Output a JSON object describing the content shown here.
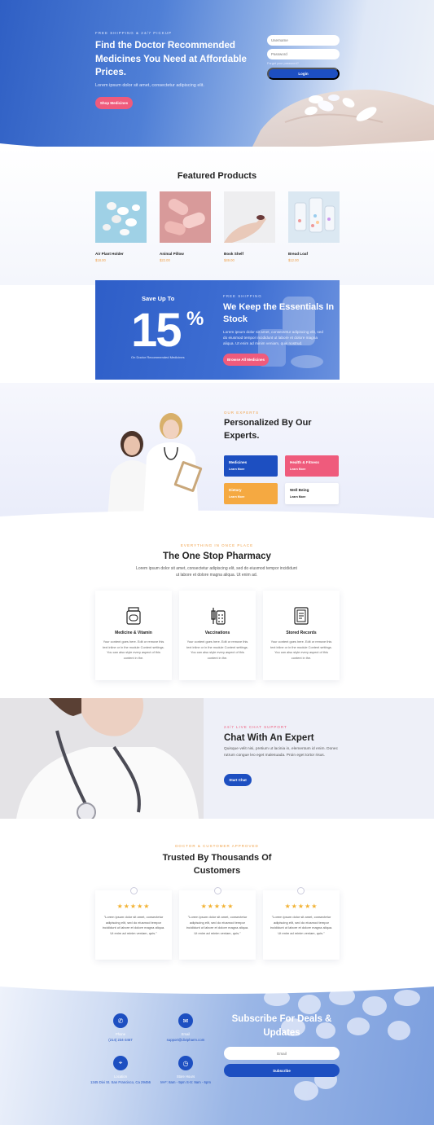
{
  "hero": {
    "eyebrow": "FREE SHIPPING & 24/7 PICKUP",
    "title": "Find the Doctor Recommended Medicines You Need at Affordable Prices.",
    "subtitle": "Lorem ipsum dolor sit amet, consectetur adipiscing elit.",
    "button": "Shop Medicines",
    "login": {
      "username_placeholder": "Username",
      "password_placeholder": "Password",
      "forgot": "Forgot your password?",
      "button": "Login"
    }
  },
  "featured": {
    "title": "Featured Products",
    "products": [
      {
        "name": "Air Plant Holder",
        "price": "$18.00"
      },
      {
        "name": "Animal Pillow",
        "price": "$22.00"
      },
      {
        "name": "Book Shelf",
        "price": "$49.00"
      },
      {
        "name": "Bread Loaf",
        "price": "$12.00"
      }
    ]
  },
  "promo": {
    "save": "Save Up To",
    "number": "15",
    "percent": "%",
    "under": "On Doctor Recommended Medicines",
    "eyebrow": "FREE SHIPPING",
    "title": "We Keep the Essentials In Stock",
    "text": "Lorem ipsum dolor sit amet, consectetur adipiscing elit, sed do eiusmod tempor incididunt ut labore et dolore magna aliqua. Ut enim ad minim veniam, quis nostrud.",
    "button": "Browse All Medicines"
  },
  "experts": {
    "eyebrow": "OUR EXPERTS",
    "title": "Personalized By Our Experts.",
    "tiles": [
      {
        "title": "Medicines",
        "link": "Learn More",
        "bg": "#1d4fc1",
        "fg": "#ffffff"
      },
      {
        "title": "Health & Fitness",
        "link": "Learn More",
        "bg": "#ef5b7c",
        "fg": "#ffffff"
      },
      {
        "title": "Dietary",
        "link": "Learn More",
        "bg": "#f5a941",
        "fg": "#ffffff"
      },
      {
        "title": "Well Being",
        "link": "Learn More",
        "bg": "#ffffff",
        "fg": "#222222"
      }
    ]
  },
  "pharmacy": {
    "eyebrow": "EVERYTHING IN ONCE PLACE",
    "title": "The One Stop Pharmacy",
    "subtitle": "Lorem ipsum dolor sit amet, consectetur adipiscing elit, sed do eiusmod tempor incididunt ut labore et dolore magna aliqua. Ut enim ad.",
    "cards": [
      {
        "icon": "medicine-jar-icon",
        "title": "Medicine & Vitamin",
        "text": "Your content goes here. Edit or remove this text inline or in the module Content settings. You can also style every aspect of this content in the."
      },
      {
        "icon": "vaccination-icon",
        "title": "Vaccinations",
        "text": "Your content goes here. Edit or remove this text inline or in the module Content settings. You can also style every aspect of this content in the."
      },
      {
        "icon": "records-icon",
        "title": "Stored Records",
        "text": "Your content goes here. Edit or remove this text inline or in the module Content settings. You can also style every aspect of this content in the."
      }
    ]
  },
  "chat": {
    "eyebrow": "24/7 LIVE CHAT SUPPORT",
    "title": "Chat With An Expert",
    "text": "Quisque velit nisi, pretium ut lacinia in, elementum id enim. Donec rutrum congue leo eget malesuada. Proin eget tortor risus.",
    "button": "Start Chat"
  },
  "testimonials": {
    "eyebrow": "DOCTOR & CUSTOMER APPROVED",
    "title": "Trusted By Thousands Of Customers",
    "items": [
      {
        "stars": "★★★★★",
        "quote": "\"Lorem ipsum dolor sit amet, consectetur adipiscing elit, sed do eiusmod tempor incididunt ut labore et dolore magna aliqua. Ut enim ad minim veniam, quis.\""
      },
      {
        "stars": "★★★★★",
        "quote": "\"Lorem ipsum dolor sit amet, consectetur adipiscing elit, sed do eiusmod tempor incididunt ut labore et dolore magna aliqua. Ut enim ad minim veniam, quis.\""
      },
      {
        "stars": "★★★★★",
        "quote": "\"Lorem ipsum dolor sit amet, consectetur adipiscing elit, sed do eiusmod tempor incididunt ut labore et dolore magna aliqua. Ut enim ad minim veniam, quis.\""
      }
    ]
  },
  "footer": {
    "contacts": [
      {
        "icon": "phone-icon",
        "glyph": "✆",
        "label": "Phone",
        "value": "(214) 234-3467"
      },
      {
        "icon": "email-icon",
        "glyph": "✉",
        "label": "Email",
        "value": "support@divipharm.com"
      },
      {
        "icon": "location-icon",
        "glyph": "⌖",
        "label": "Location",
        "value": "1345 Divi St. San Francisco, Ca 29456"
      },
      {
        "icon": "clock-icon",
        "glyph": "◷",
        "label": "Store Hours",
        "value": "M-F: 8am - 9pm S-S: 9am - 6pm"
      }
    ],
    "subscribe_title": "Subscribe For Deals & Updates",
    "email_placeholder": "Email",
    "subscribe_button": "Subscribe"
  },
  "colors": {
    "brand_blue": "#1d4fc1",
    "accent_pink": "#ef5b7c",
    "accent_orange": "#f0a24a",
    "star": "#f2b233"
  }
}
